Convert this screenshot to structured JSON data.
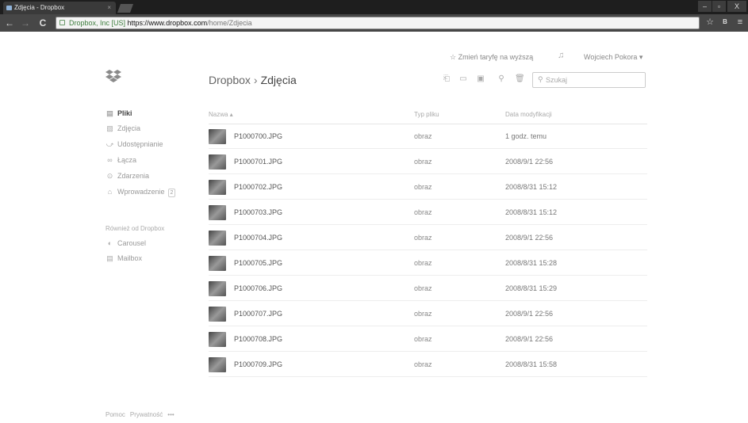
{
  "browser": {
    "tab_title": "Zdjęcia - Dropbox",
    "tab_close": "×",
    "url_ssl": "Dropbox, Inc [US]",
    "url_host": "https://www.dropbox.com",
    "url_path": "/home/Zdjecia",
    "win_min": "–",
    "win_max": "▫",
    "win_close": "X",
    "icons": {
      "back": "←",
      "forward": "→",
      "reload": "C",
      "star": "☆",
      "ext": "B",
      "menu": "≡"
    }
  },
  "header": {
    "upgrade": "☆ Zmień taryfę na wyższą",
    "bell": "♫",
    "user": "Wojciech Pokora ▾"
  },
  "breadcrumb": {
    "root": "Dropbox",
    "sep": "›",
    "current": "Zdjęcia"
  },
  "search": {
    "placeholder": "Szukaj",
    "icon": "⚲"
  },
  "actions": {
    "upload": "⎗",
    "new_folder": "▭",
    "share_folder": "▣",
    "link": "⚲",
    "delete": "🗑"
  },
  "sidebar": {
    "items": [
      {
        "icon": "▤",
        "label": "Pliki"
      },
      {
        "icon": "▨",
        "label": "Zdjęcia"
      },
      {
        "icon": "⤻",
        "label": "Udostępnianie"
      },
      {
        "icon": "∞",
        "label": "Łącza"
      },
      {
        "icon": "⊙",
        "label": "Zdarzenia"
      },
      {
        "icon": "⌂",
        "label": "Wprowadzenie",
        "badge": "2"
      }
    ],
    "also_header": "Również od Dropbox",
    "also_items": [
      {
        "icon": "◐",
        "label": "Carousel"
      },
      {
        "icon": "▤",
        "label": "Mailbox"
      }
    ]
  },
  "table": {
    "columns": {
      "name": "Nazwa ▴",
      "type": "Typ pliku",
      "date": "Data modyfikacji"
    },
    "rows": [
      {
        "name": "P1000700.JPG",
        "type": "obraz",
        "date": "1 godz. temu"
      },
      {
        "name": "P1000701.JPG",
        "type": "obraz",
        "date": "2008/9/1 22:56"
      },
      {
        "name": "P1000702.JPG",
        "type": "obraz",
        "date": "2008/8/31 15:12"
      },
      {
        "name": "P1000703.JPG",
        "type": "obraz",
        "date": "2008/8/31 15:12"
      },
      {
        "name": "P1000704.JPG",
        "type": "obraz",
        "date": "2008/9/1 22:56"
      },
      {
        "name": "P1000705.JPG",
        "type": "obraz",
        "date": "2008/8/31 15:28"
      },
      {
        "name": "P1000706.JPG",
        "type": "obraz",
        "date": "2008/8/31 15:29"
      },
      {
        "name": "P1000707.JPG",
        "type": "obraz",
        "date": "2008/9/1 22:56"
      },
      {
        "name": "P1000708.JPG",
        "type": "obraz",
        "date": "2008/9/1 22:56"
      },
      {
        "name": "P1000709.JPG",
        "type": "obraz",
        "date": "2008/8/31 15:58"
      }
    ]
  },
  "footer": {
    "help": "Pomoc",
    "privacy": "Prywatność",
    "more": "•••"
  }
}
